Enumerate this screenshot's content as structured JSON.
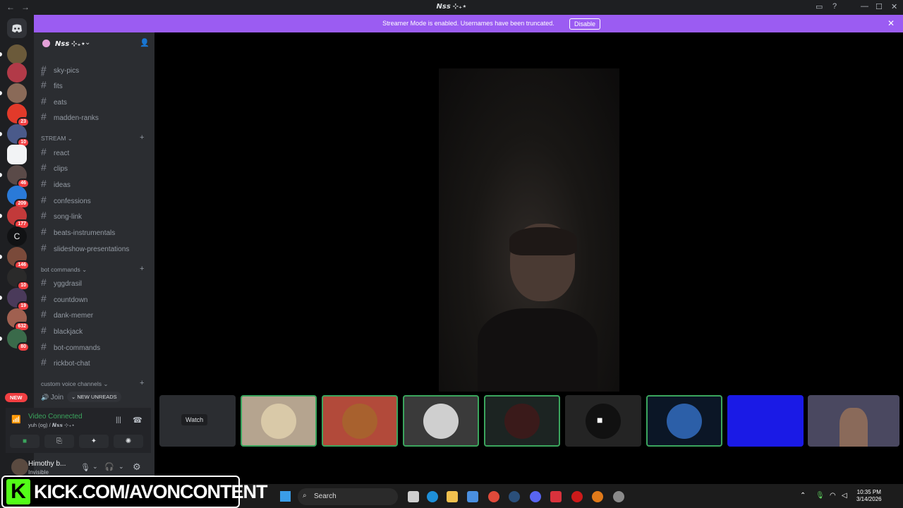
{
  "window": {
    "title": "𝙉𝙨𝙨 ⊹₊⋆"
  },
  "banner": {
    "text": "Streamer Mode is enabled. Usernames have been truncated.",
    "button": "Disable"
  },
  "guilds": [
    {
      "badge": ""
    },
    {
      "badge": ""
    },
    {
      "badge": ""
    },
    {
      "badge": "23"
    },
    {
      "badge": "10"
    },
    {
      "badge": ""
    },
    {
      "badge": "46"
    },
    {
      "badge": "209"
    },
    {
      "badge": "177"
    },
    {
      "badge": "",
      "letter": "C"
    },
    {
      "badge": "146"
    },
    {
      "badge": "10"
    },
    {
      "badge": "19"
    },
    {
      "badge": "632"
    },
    {
      "badge": "80"
    }
  ],
  "new_pill": "NEW",
  "server": {
    "name": "𝙉𝙨𝙨 ⊹₊⋆"
  },
  "channels_top": [
    "sky-pics",
    "fits",
    "eats",
    "madden-ranks"
  ],
  "categories": {
    "stream": "STREAM",
    "bot": "bot commands",
    "voice": "custom voice channels"
  },
  "stream_channels": [
    "react",
    "clips",
    "ideas",
    "confessions",
    "song-link",
    "beats-instrumentals",
    "slideshow-presentations"
  ],
  "bot_channels": [
    "yggdrasil",
    "countdown",
    "dank-memer",
    "blackjack",
    "bot-commands",
    "rickbot-chat"
  ],
  "voice_channel_partial": "Join",
  "new_unreads": "NEW UNREADS",
  "voice": {
    "status": "Video Connected",
    "sub": "yuh (og) / 𝙉𝙨𝙨 ⊹₊⋆"
  },
  "user": {
    "name": "Himothy b...",
    "status": "Invisible"
  },
  "tiles": {
    "watch": "Watch"
  },
  "taskbar": {
    "search": "Search",
    "time": "10:35 PM",
    "date": "3/14/2026"
  },
  "overlay": {
    "kick_letter": "K",
    "kick_text": "KICK.COM/AVONCONTENT"
  }
}
